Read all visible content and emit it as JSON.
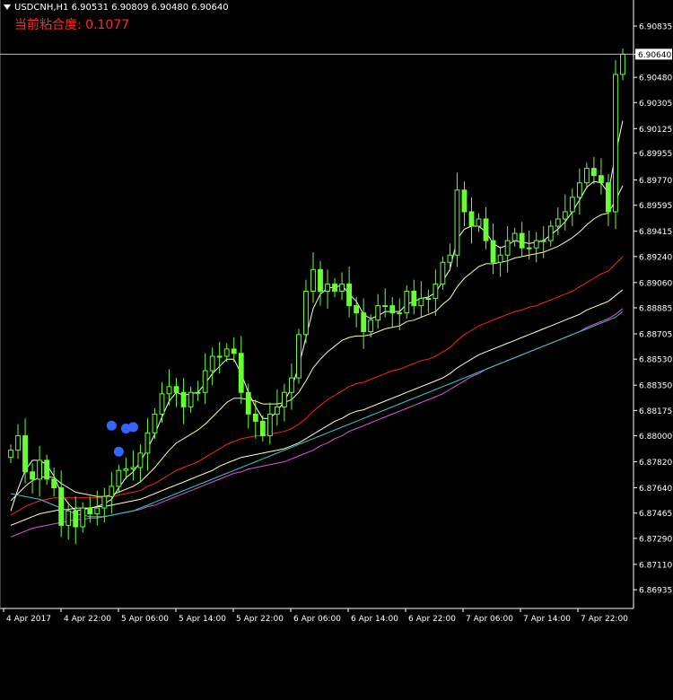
{
  "header": {
    "symbol": "USDCNH,H1",
    "open": "6.90531",
    "high": "6.90809",
    "low": "6.90480",
    "close": "6.90640"
  },
  "indicator": {
    "label": "当前粘合度:",
    "value": "0.1077"
  },
  "current_price_label": "6.90640",
  "colors": {
    "background": "#000000",
    "candle": "#66ff33",
    "axis": "#ffffff",
    "ma_fast": "#ffffff",
    "ma_mid": "#ffff99",
    "ma_red": "#ff2222",
    "ma_beige": "#ffffcc",
    "ma_magenta": "#dd55dd",
    "ma_cyan": "#33cccc",
    "markers": "#3366ff",
    "indicator_text": "#ff2a2a"
  },
  "chart_data": {
    "type": "candlestick",
    "title": "USDCNH,H1",
    "ylim": [
      6.86805,
      6.91015
    ],
    "y_ticks": [
      "6.90835",
      "6.90640",
      "6.90480",
      "6.90305",
      "6.90125",
      "6.89955",
      "6.89770",
      "6.89595",
      "6.89415",
      "6.89240",
      "6.89060",
      "6.88885",
      "6.88705",
      "6.88530",
      "6.88350",
      "6.88175",
      "6.88000",
      "6.87820",
      "6.87640",
      "6.87465",
      "6.87290",
      "6.87110",
      "6.86935"
    ],
    "x_ticks": [
      "4 Apr 2017",
      "4 Apr 22:00",
      "5 Apr 06:00",
      "5 Apr 14:00",
      "5 Apr 22:00",
      "6 Apr 06:00",
      "6 Apr 14:00",
      "6 Apr 22:00",
      "7 Apr 06:00",
      "7 Apr 14:00",
      "7 Apr 22:00"
    ],
    "bar_count": 86,
    "close": [
      6.879,
      6.88,
      6.8775,
      6.877,
      6.8783,
      6.877,
      6.8764,
      6.8738,
      6.8748,
      6.8737,
      6.875,
      6.8746,
      6.875,
      6.8758,
      6.8765,
      6.8776,
      6.8777,
      6.8778,
      6.8788,
      6.8802,
      6.8815,
      6.8829,
      6.8834,
      6.883,
      6.882,
      6.883,
      6.883,
      6.8845,
      6.8855,
      6.8855,
      6.886,
      6.8857,
      6.883,
      6.8815,
      6.881,
      6.88,
      6.8815,
      6.882,
      6.883,
      6.884,
      6.887,
      6.89,
      6.8915,
      6.89,
      6.8905,
      6.89,
      6.8905,
      6.889,
      6.8885,
      6.8872,
      6.888,
      6.889,
      6.889,
      6.8885,
      6.8885,
      6.89,
      6.889,
      6.8895,
      6.8895,
      6.8905,
      6.892,
      6.8925,
      6.897,
      6.8955,
      6.8945,
      6.895,
      6.8935,
      6.892,
      6.8925,
      6.8935,
      6.894,
      6.893,
      6.893,
      6.8935,
      6.8935,
      6.8945,
      6.895,
      6.8955,
      6.8965,
      6.8975,
      6.8985,
      6.898,
      6.8975,
      6.8955,
      6.905,
      6.9064
    ],
    "series": [
      {
        "color": "#ffffff",
        "values": [
          6.8748,
          6.8763,
          6.8776,
          6.8783,
          6.8783,
          6.878,
          6.8772,
          6.876,
          6.8753,
          6.8748,
          6.8749,
          6.875,
          6.8751,
          6.8753,
          6.8756,
          6.8764,
          6.8771,
          6.8775,
          6.8782,
          6.8791,
          6.8801,
          6.8813,
          6.8824,
          6.883,
          6.8828,
          6.8829,
          6.883,
          6.8836,
          6.8843,
          6.8848,
          6.8853,
          6.8853,
          6.8843,
          6.883,
          6.882,
          6.8812,
          6.8812,
          6.8817,
          6.8824,
          6.8833,
          6.8848,
          6.8868,
          6.8888,
          6.8898,
          6.8902,
          6.8903,
          6.8904,
          6.8898,
          6.8893,
          6.8884,
          6.8881,
          6.8883,
          6.8886,
          6.8886,
          6.8886,
          6.8891,
          6.8893,
          6.8895,
          6.8896,
          6.8899,
          6.8907,
          6.8915,
          6.8936,
          6.8943,
          6.8945,
          6.8945,
          6.8941,
          6.8933,
          6.893,
          6.8932,
          6.8935,
          6.8934,
          6.8933,
          6.8934,
          6.8935,
          6.8939,
          6.8943,
          6.8948,
          6.8955,
          6.8963,
          6.8972,
          6.8976,
          6.8975,
          6.8968,
          6.8995,
          6.9018
        ]
      },
      {
        "color": "#ffff99",
        "values": [
          6.8755,
          6.876,
          6.8765,
          6.8769,
          6.8771,
          6.8772,
          6.8771,
          6.8767,
          6.8764,
          6.8761,
          6.876,
          6.8759,
          6.8758,
          6.8758,
          6.8759,
          6.8761,
          6.8763,
          6.8765,
          6.8768,
          6.8773,
          6.8778,
          6.8784,
          6.879,
          6.8795,
          6.8798,
          6.8801,
          6.8804,
          6.8808,
          6.8813,
          6.8818,
          6.8823,
          6.8826,
          6.8826,
          6.8825,
          6.8824,
          6.8822,
          6.8822,
          6.8822,
          6.8823,
          6.8825,
          6.883,
          6.8838,
          6.8847,
          6.8853,
          6.8858,
          6.8862,
          6.8866,
          6.8868,
          6.8869,
          6.8869,
          6.887,
          6.8872,
          6.8874,
          6.8875,
          6.8876,
          6.8879,
          6.888,
          6.8882,
          6.8884,
          6.8886,
          6.8891,
          6.8895,
          6.8903,
          6.8909,
          6.8913,
          6.8917,
          6.8919,
          6.8919,
          6.892,
          6.8921,
          6.8923,
          6.8924,
          6.8925,
          6.8926,
          6.8927,
          6.8929,
          6.8931,
          6.8934,
          6.8937,
          6.8941,
          6.8946,
          6.895,
          6.8953,
          6.8954,
          6.8963,
          6.8973
        ]
      },
      {
        "color": "#ff2222",
        "values": [
          6.8745,
          6.8748,
          6.8751,
          6.8753,
          6.8755,
          6.8756,
          6.8757,
          6.8757,
          6.8757,
          6.8757,
          6.8757,
          6.8757,
          6.8757,
          6.8757,
          6.8758,
          6.8759,
          6.876,
          6.8761,
          6.8762,
          6.8765,
          6.8767,
          6.877,
          6.8773,
          6.8776,
          6.8778,
          6.878,
          6.8782,
          6.8785,
          6.8788,
          6.8791,
          6.8794,
          6.8796,
          6.8798,
          6.8799,
          6.88,
          6.88,
          6.8801,
          6.8802,
          6.8803,
          6.8805,
          6.8808,
          6.8812,
          6.8817,
          6.8821,
          6.8825,
          6.8828,
          6.8831,
          6.8834,
          6.8836,
          6.8837,
          6.8839,
          6.8841,
          6.8843,
          6.8845,
          6.8846,
          6.8848,
          6.885,
          6.8852,
          6.8853,
          6.8855,
          6.8858,
          6.8861,
          6.8866,
          6.887,
          6.8873,
          6.8876,
          6.8878,
          6.888,
          6.8882,
          6.8884,
          6.8886,
          6.8887,
          6.8889,
          6.889,
          6.8892,
          6.8894,
          6.8896,
          6.8898,
          6.89,
          6.8903,
          6.8906,
          6.8909,
          6.8912,
          6.8914,
          6.8919,
          6.8924
        ]
      },
      {
        "color": "#ffffcc",
        "values": [
          6.8738,
          6.874,
          6.8742,
          6.8744,
          6.8746,
          6.8747,
          6.8748,
          6.8749,
          6.8749,
          6.875,
          6.875,
          6.875,
          6.8751,
          6.8751,
          6.8752,
          6.8753,
          6.8754,
          6.8755,
          6.8756,
          6.8758,
          6.876,
          6.8762,
          6.8764,
          6.8766,
          6.8768,
          6.877,
          6.8772,
          6.8774,
          6.8776,
          6.8779,
          6.8781,
          6.8783,
          6.8785,
          6.8786,
          6.8787,
          6.8788,
          6.8789,
          6.879,
          6.8791,
          6.8793,
          6.8795,
          6.8798,
          6.8801,
          6.8804,
          6.8807,
          6.881,
          6.8812,
          6.8815,
          6.8817,
          6.8818,
          6.882,
          6.8822,
          6.8824,
          6.8826,
          6.8828,
          6.883,
          6.8832,
          6.8834,
          6.8836,
          6.8838,
          6.884,
          6.8843,
          6.8847,
          6.885,
          6.8853,
          6.8856,
          6.8858,
          6.886,
          6.8862,
          6.8864,
          6.8866,
          6.8868,
          6.887,
          6.8872,
          6.8874,
          6.8876,
          6.8878,
          6.888,
          6.8882,
          6.8884,
          6.8887,
          6.8889,
          6.8891,
          6.8893,
          6.8897,
          6.8901
        ]
      },
      {
        "color": "#dd55dd",
        "values": [
          6.873,
          6.8732,
          6.8734,
          6.8736,
          6.8737,
          6.8738,
          6.8739,
          6.874,
          6.8741,
          6.8742,
          6.8742,
          6.8743,
          6.8743,
          6.8744,
          6.8745,
          6.8746,
          6.8747,
          6.8748,
          6.8749,
          6.8751,
          6.8752,
          6.8754,
          6.8756,
          6.8758,
          6.876,
          6.8762,
          6.8764,
          6.8766,
          6.8768,
          6.877,
          6.8772,
          6.8774,
          6.8775,
          6.8777,
          6.8778,
          6.8779,
          6.878,
          6.8781,
          6.8782,
          6.8784,
          6.8786,
          6.8788,
          6.879,
          6.8793,
          6.8795,
          6.8798,
          6.88,
          6.8803,
          6.8805,
          6.8807,
          6.8809,
          6.8811,
          6.8813,
          6.8815,
          6.8817,
          6.8819,
          6.8821,
          6.8823,
          6.8825,
          6.8827,
          6.8829,
          6.8832,
          6.8835,
          6.8838,
          6.8841,
          6.8843,
          6.8846,
          6.8848,
          6.885,
          6.8852,
          6.8854,
          6.8856,
          6.8858,
          6.886,
          6.8862,
          6.8864,
          6.8866,
          6.8868,
          6.887,
          6.8872,
          6.8875,
          6.8877,
          6.8879,
          6.8881,
          6.8884,
          6.8888
        ]
      },
      {
        "color": "#33cccc",
        "values": [
          6.876,
          6.8759,
          6.8758,
          6.8757,
          6.8756,
          6.8754,
          6.8752,
          6.875,
          6.8748,
          6.8746,
          6.8745,
          6.8744,
          6.8744,
          6.8744,
          6.8745,
          6.8746,
          6.8747,
          6.8748,
          6.875,
          6.8752,
          6.8754,
          6.8756,
          6.8758,
          6.876,
          6.8762,
          6.8764,
          6.8766,
          6.8768,
          6.877,
          6.8772,
          6.8774,
          6.8776,
          6.8778,
          6.878,
          6.8782,
          6.8784,
          6.8786,
          6.8788,
          6.879,
          6.8792,
          6.8794,
          6.8796,
          6.8798,
          6.88,
          6.8802,
          6.8804,
          6.8806,
          6.8808,
          6.881,
          6.8812,
          6.8814,
          6.8816,
          6.8818,
          6.882,
          6.8822,
          6.8824,
          6.8826,
          6.8828,
          6.883,
          6.8832,
          6.8834,
          6.8836,
          6.8838,
          6.884,
          6.8842,
          6.8844,
          6.8846,
          6.8848,
          6.885,
          6.8852,
          6.8854,
          6.8856,
          6.8858,
          6.886,
          6.8862,
          6.8864,
          6.8866,
          6.8868,
          6.887,
          6.8872,
          6.8874,
          6.8876,
          6.8878,
          6.888,
          6.8882,
          6.8886
        ]
      }
    ],
    "markers": [
      {
        "bar": 14,
        "price": 6.8807
      },
      {
        "bar": 16,
        "price": 6.8805
      },
      {
        "bar": 17,
        "price": 6.8806
      },
      {
        "bar": 15,
        "price": 6.8789
      }
    ]
  }
}
